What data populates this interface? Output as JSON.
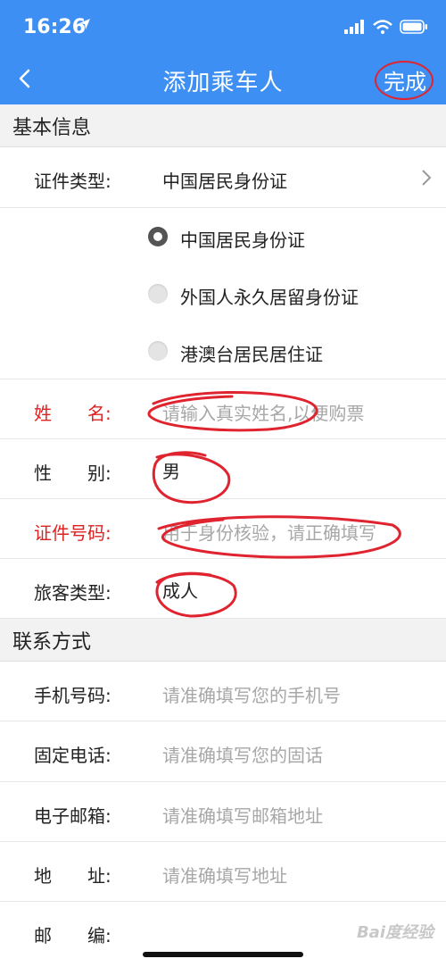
{
  "status_bar": {
    "time": "16:26"
  },
  "nav": {
    "title": "添加乘车人",
    "done_label": "完成"
  },
  "basic_info": {
    "header": "基本信息",
    "id_type": {
      "label": "证件类型:",
      "value": "中国居民身份证"
    },
    "id_options": [
      {
        "label": "中国居民身份证",
        "checked": true
      },
      {
        "label": "外国人永久居留身份证",
        "checked": false
      },
      {
        "label": "港澳台居民居住证",
        "checked": false
      }
    ],
    "name": {
      "label": "姓　　名:",
      "placeholder": "请输入真实姓名,以便购票"
    },
    "gender": {
      "label": "性　　别:",
      "value": "男"
    },
    "id_number": {
      "label": "证件号码:",
      "placeholder": "用于身份核验，请正确填写"
    },
    "passenger_type": {
      "label": "旅客类型:",
      "value": "成人"
    }
  },
  "contact": {
    "header": "联系方式",
    "mobile": {
      "label": "手机号码:",
      "placeholder": "请准确填写您的手机号"
    },
    "landline": {
      "label": "固定电话:",
      "placeholder": "请准确填写您的固话"
    },
    "email": {
      "label": "电子邮箱:",
      "placeholder": "请准确填写邮箱地址"
    },
    "address": {
      "label": "地　　址:",
      "placeholder": "请准确填写地址"
    },
    "postcode": {
      "label": "邮　　编:"
    }
  },
  "colors": {
    "primary": "#3d8ff4",
    "required": "#d22222",
    "annotation": "#e0242f"
  },
  "watermark": "Bai度经验"
}
